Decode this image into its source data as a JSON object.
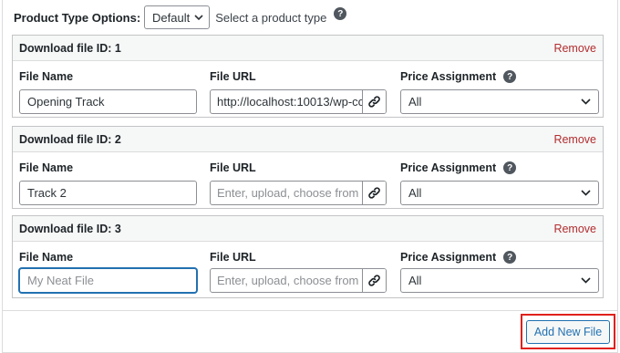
{
  "product_type": {
    "label": "Product Type Options:",
    "selected": "Default",
    "hint": "Select a product type"
  },
  "columns": {
    "file_name": "File Name",
    "file_url": "File URL",
    "price_assignment": "Price Assignment"
  },
  "files": [
    {
      "title": "Download file ID: 1",
      "remove": "Remove",
      "name": "Opening Track",
      "url": "http://localhost:10013/wp-co",
      "url_placeholder": "",
      "price": "All"
    },
    {
      "title": "Download file ID: 2",
      "remove": "Remove",
      "name": "Track 2",
      "url": "",
      "url_placeholder": "Enter, upload, choose from M",
      "price": "All"
    },
    {
      "title": "Download file ID: 3",
      "remove": "Remove",
      "name": "",
      "name_placeholder": "My Neat File",
      "url": "",
      "url_placeholder": "Enter, upload, choose from M",
      "price": "All"
    }
  ],
  "add_button": "Add New File",
  "colors": {
    "remove": "#b32d2e",
    "accent": "#2271b1",
    "highlight": "#e0201b"
  }
}
